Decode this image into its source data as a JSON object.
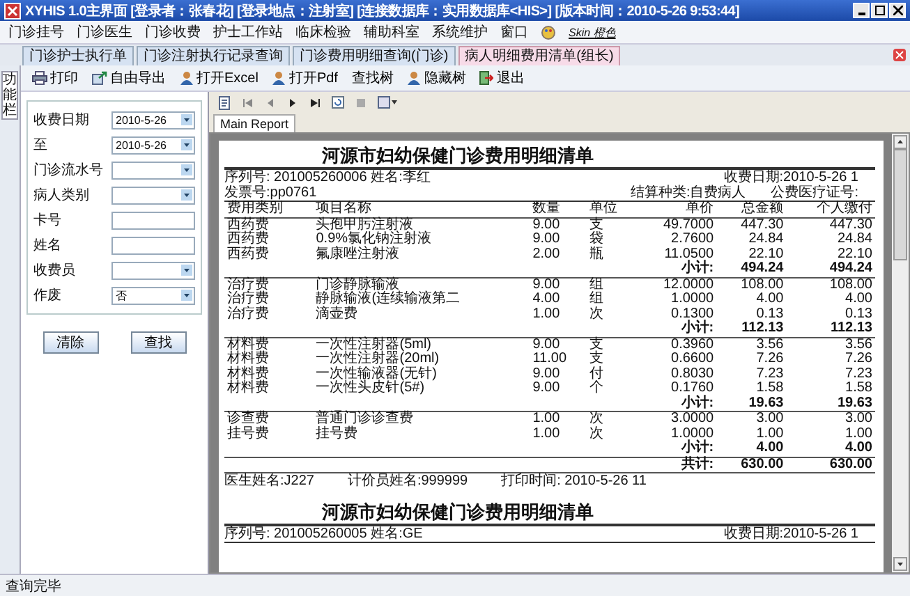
{
  "window": {
    "title": "XYHIS 1.0主界面  [登录者：张春花] [登录地点：注射室] [连接数据库：实用数据库<HIS>] [版本时间：2010-5-26 9:53:44]"
  },
  "menu": [
    "门诊挂号",
    "门诊医生",
    "门诊收费",
    "护士工作站",
    "临床检验",
    "辅助科室",
    "系统维护",
    "窗口"
  ],
  "skin": "Skin 橙色",
  "side_tab": "功能栏",
  "doc_tabs": [
    {
      "label": "门诊护士执行单",
      "selected": false
    },
    {
      "label": "门诊注射执行记录查询",
      "selected": false
    },
    {
      "label": "门诊费用明细查询(门诊)",
      "selected": false
    },
    {
      "label": "病人明细费用清单(组长)",
      "selected": true
    }
  ],
  "toolbar": [
    {
      "label": "打印",
      "kind": "print"
    },
    {
      "label": "自由导出",
      "kind": "export"
    },
    {
      "label": "打开Excel",
      "kind": "open"
    },
    {
      "label": "打开Pdf",
      "kind": "open"
    },
    {
      "label": "查找树",
      "kind": "text"
    },
    {
      "label": "隐藏树",
      "kind": "open"
    },
    {
      "label": "退出",
      "kind": "exit"
    }
  ],
  "form": [
    {
      "label": "收费日期",
      "kind": "dropdown",
      "value": "2010-5-26"
    },
    {
      "label": "至",
      "kind": "dropdown",
      "value": "2010-5-26"
    },
    {
      "label": "门诊流水号",
      "kind": "dropdown"
    },
    {
      "label": "病人类别",
      "kind": "dropdown"
    },
    {
      "label": "卡号",
      "kind": "text"
    },
    {
      "label": "姓名",
      "kind": "text"
    },
    {
      "label": "收费员",
      "kind": "dropdown"
    },
    {
      "label": "作废",
      "kind": "dropdown",
      "value": "否"
    }
  ],
  "form_buttons": [
    "清除",
    "查找"
  ],
  "report_tab": "Main Report",
  "reports": [
    {
      "title": "河源市妇幼保健门诊费用明细清单",
      "info": [
        [
          "序列号: 201005260006 姓名:李红",
          "收费日期:2010-5-26  1"
        ],
        [
          "发票号:pp0761",
          "结算种类:自费病人",
          "公费医疗证号:"
        ]
      ],
      "columns": [
        "费用类别",
        "项目名称",
        "数量",
        "单位",
        "单价",
        "总金额",
        "个人缴付"
      ],
      "groups": [
        {
          "rows": [
            [
              "西药费",
              "头孢甲肟注射液",
              "9.00",
              "支",
              "49.7000",
              "447.30",
              "447.30"
            ],
            [
              "西药费",
              "0.9%氯化钠注射液",
              "9.00",
              "袋",
              "2.7600",
              "24.84",
              "24.84"
            ],
            [
              "西药费",
              "氟康唑注射液",
              "2.00",
              "瓶",
              "11.0500",
              "22.10",
              "22.10"
            ]
          ],
          "subtotal_label": "小计:",
          "subtotal": "494.24",
          "subtotal_personal": "494.24"
        },
        {
          "rows": [
            [
              "治疗费",
              "门诊静脉输液",
              "9.00",
              "组",
              "12.0000",
              "108.00",
              "108.00"
            ],
            [
              "治疗费",
              "静脉输液(连续输液第二",
              "4.00",
              "组",
              "1.0000",
              "4.00",
              "4.00"
            ],
            [
              "治疗费",
              "滴壶费",
              "1.00",
              "次",
              "0.1300",
              "0.13",
              "0.13"
            ]
          ],
          "subtotal_label": "小计:",
          "subtotal": "112.13",
          "subtotal_personal": "112.13"
        },
        {
          "rows": [
            [
              "材料费",
              "一次性注射器(5ml)",
              "9.00",
              "支",
              "0.3960",
              "3.56",
              "3.56"
            ],
            [
              "材料费",
              "一次性注射器(20ml)",
              "11.00",
              "支",
              "0.6600",
              "7.26",
              "7.26"
            ],
            [
              "材料费",
              "一次性输液器(无针)",
              "9.00",
              "付",
              "0.8030",
              "7.23",
              "7.23"
            ],
            [
              "材料费",
              "一次性头皮针(5#)",
              "9.00",
              "个",
              "0.1760",
              "1.58",
              "1.58"
            ]
          ],
          "subtotal_label": "小计:",
          "subtotal": "19.63",
          "subtotal_personal": "19.63"
        },
        {
          "rows": [
            [
              "诊查费",
              "普通门诊诊查费",
              "1.00",
              "次",
              "3.0000",
              "3.00",
              "3.00"
            ],
            [
              "挂号费",
              "挂号费",
              "1.00",
              "次",
              "1.0000",
              "1.00",
              "1.00"
            ]
          ],
          "subtotal_label": "小计:",
          "subtotal": "4.00",
          "subtotal_personal": "4.00"
        }
      ],
      "total_label": "共计:",
      "total": "630.00",
      "total_personal": "630.00",
      "footer": [
        "医生姓名:J227",
        "计价员姓名:999999",
        "打印时间: 2010-5-26 11"
      ]
    },
    {
      "title": "河源市妇幼保健门诊费用明细清单",
      "info": [
        [
          "序列号: 201005260005 姓名:GE",
          "收费日期:2010-5-26  1"
        ]
      ]
    }
  ],
  "status_bar": "查询完毕"
}
